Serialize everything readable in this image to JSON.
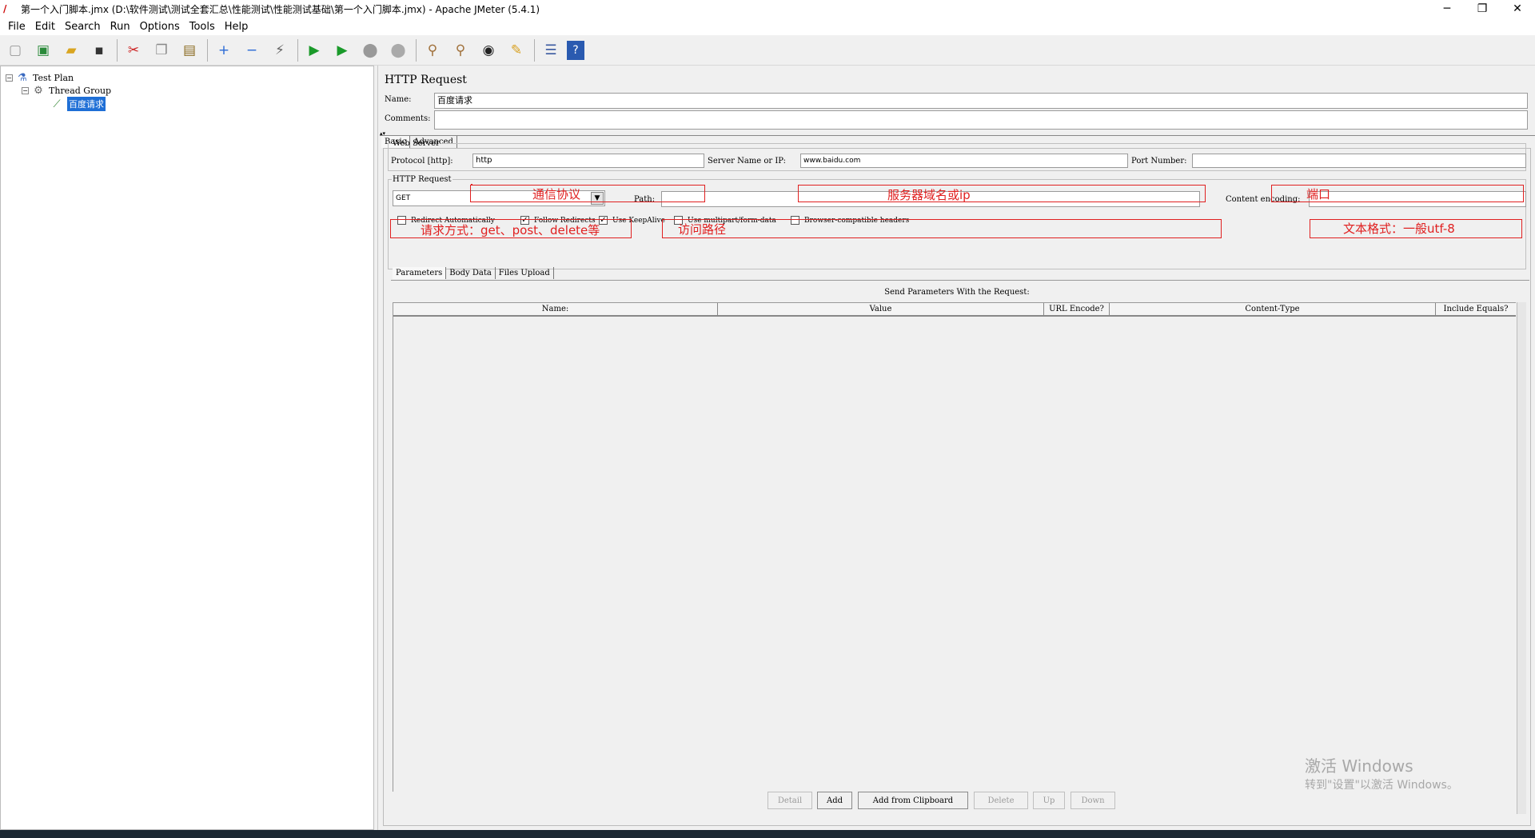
{
  "window": {
    "title": "第一个入门脚本.jmx (D:\\软件测试\\测试全套汇总\\性能测试\\性能测试基础\\第一个入门脚本.jmx) - Apache JMeter (5.4.1)",
    "minimize": "─",
    "maximize": "❐",
    "close": "✕"
  },
  "menu": [
    "File",
    "Edit",
    "Search",
    "Run",
    "Options",
    "Tools",
    "Help"
  ],
  "tree": {
    "test_plan": "Test Plan",
    "thread_group": "Thread Group",
    "sampler": "百度请求"
  },
  "panel": {
    "title": "HTTP Request",
    "name_label": "Name:",
    "name_value": "百度请求",
    "comments_label": "Comments:",
    "comments_value": "",
    "tabs": [
      "Basic",
      "Advanced"
    ]
  },
  "web_server": {
    "legend": "Web Server",
    "protocol_label": "Protocol [http]:",
    "protocol_value": "http",
    "server_label": "Server Name or IP:",
    "server_value": "www.baidu.com",
    "port_label": "Port Number:",
    "port_value": ""
  },
  "http_request": {
    "legend": "HTTP Request",
    "method_value": "GET",
    "path_label": "Path:",
    "path_value": "",
    "encoding_label": "Content encoding:",
    "encoding_value": ""
  },
  "options": {
    "redirect_auto": {
      "label": "Redirect Automatically",
      "checked": false
    },
    "follow_redirects": {
      "label": "Follow Redirects",
      "checked": true
    },
    "keepalive": {
      "label": "Use KeepAlive",
      "checked": true
    },
    "multipart": {
      "label": "Use multipart/form-data",
      "checked": false
    },
    "browser_headers": {
      "label": "Browser-compatible headers",
      "checked": false
    }
  },
  "subtabs": [
    "Parameters",
    "Body Data",
    "Files Upload"
  ],
  "params": {
    "caption": "Send Parameters With the Request:",
    "columns": [
      "Name:",
      "Value",
      "URL Encode?",
      "Content-Type",
      "Include Equals?"
    ]
  },
  "buttons": {
    "detail": "Detail",
    "add": "Add",
    "add_clipboard": "Add from Clipboard",
    "delete": "Delete",
    "up": "Up",
    "down": "Down"
  },
  "annotations": {
    "protocol": "通信协议",
    "server": "服务器域名或ip",
    "port": "端口",
    "method": "请求方式：get、post、delete等",
    "path": "访问路径",
    "encoding": "文本格式：一般utf-8"
  },
  "watermark": {
    "line1": "激活 Windows",
    "line2": "转到\"设置\"以激活 Windows。"
  },
  "colors": {
    "annotation": "#e02020",
    "selection": "#1f6fd6"
  }
}
